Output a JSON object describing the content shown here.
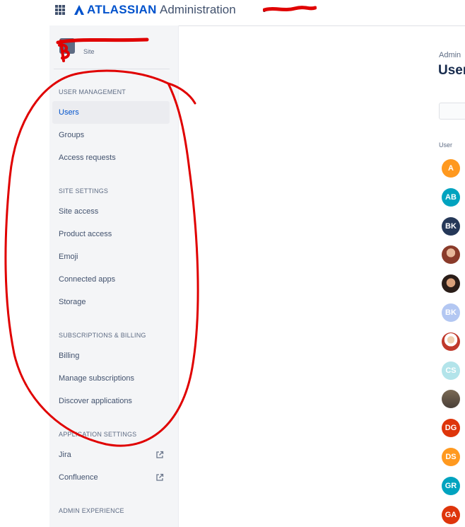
{
  "topbar": {
    "brand": "ATLASSIAN",
    "title": "Administration",
    "site_name": "s",
    "icons": {
      "app_switcher": "grid-icon",
      "logo": "atlassian-logo"
    }
  },
  "sidebar": {
    "site_label": "Site",
    "sections": [
      {
        "heading": "USER MANAGEMENT",
        "items": [
          {
            "label": "Users",
            "active": true
          },
          {
            "label": "Groups"
          },
          {
            "label": "Access requests"
          }
        ]
      },
      {
        "heading": "SITE SETTINGS",
        "items": [
          {
            "label": "Site access"
          },
          {
            "label": "Product access"
          },
          {
            "label": "Emoji"
          },
          {
            "label": "Connected apps"
          },
          {
            "label": "Storage"
          }
        ]
      },
      {
        "heading": "SUBSCRIPTIONS & BILLING",
        "items": [
          {
            "label": "Billing"
          },
          {
            "label": "Manage subscriptions"
          },
          {
            "label": "Discover applications"
          }
        ]
      },
      {
        "heading": "APPLICATION SETTINGS",
        "items": [
          {
            "label": "Jira",
            "icon": "external-link-icon"
          },
          {
            "label": "Confluence",
            "icon": "external-link-icon"
          }
        ]
      },
      {
        "heading": "ADMIN EXPERIENCE",
        "items": []
      }
    ]
  },
  "main": {
    "breadcrumb": "Admin",
    "title": "User",
    "column_header": "User",
    "users": [
      {
        "initials": "A",
        "color": "#ff991f"
      },
      {
        "initials": "AB",
        "color": "#00a3bf"
      },
      {
        "initials": "BK",
        "color": "#253858"
      },
      {
        "initials": "",
        "photo": "photo-avatar-woman"
      },
      {
        "initials": "",
        "photo": "photo-avatar-man"
      },
      {
        "initials": "BK",
        "color": "#b3c7f2"
      },
      {
        "initials": "",
        "photo": "photo-avatar-cartoon"
      },
      {
        "initials": "CS",
        "color": "#b3e4ea"
      },
      {
        "initials": "",
        "photo": "photo-avatar-scene"
      },
      {
        "initials": "DG",
        "color": "#de350b"
      },
      {
        "initials": "DS",
        "color": "#ff991f"
      },
      {
        "initials": "GR",
        "color": "#00a3bf"
      },
      {
        "initials": "GA",
        "color": "#de350b"
      }
    ]
  },
  "colors": {
    "accent": "#0052cc",
    "annotation": "#e00000"
  }
}
